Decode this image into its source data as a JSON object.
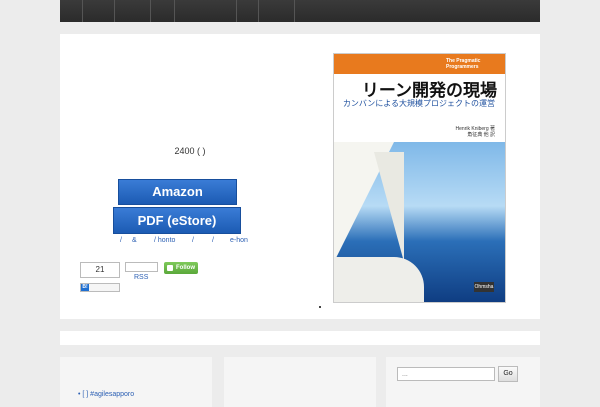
{
  "nav": {},
  "product": {
    "price": "2400 ( )",
    "amazon_label": "Amazon",
    "pdf_label": "PDF       (eStore)",
    "stores": [
      "/",
      "&",
      "/ honto",
      "/",
      "/",
      "e-hon"
    ]
  },
  "social": {
    "count": "21",
    "rss_label": "RSS",
    "follow_label": "Follow",
    "hatena_label": "B!"
  },
  "book": {
    "series": "The Pragmatic Programmers",
    "title": "リーン開発の現場",
    "subtitle": "カンバンによる大規模プロジェクトの運営",
    "author": "Henrik Kniberg 著",
    "translators": "角征典 他 訳",
    "publisher": "Ohmsha"
  },
  "sidebar": {
    "tag_text": "• [   ]                  #agilesapporo"
  },
  "search": {
    "placeholder": "...",
    "go_label": "Go"
  },
  "colors": {
    "accent_blue": "#1c5bb3",
    "follow_green": "#5aa83a",
    "book_orange": "#e87a1e"
  }
}
